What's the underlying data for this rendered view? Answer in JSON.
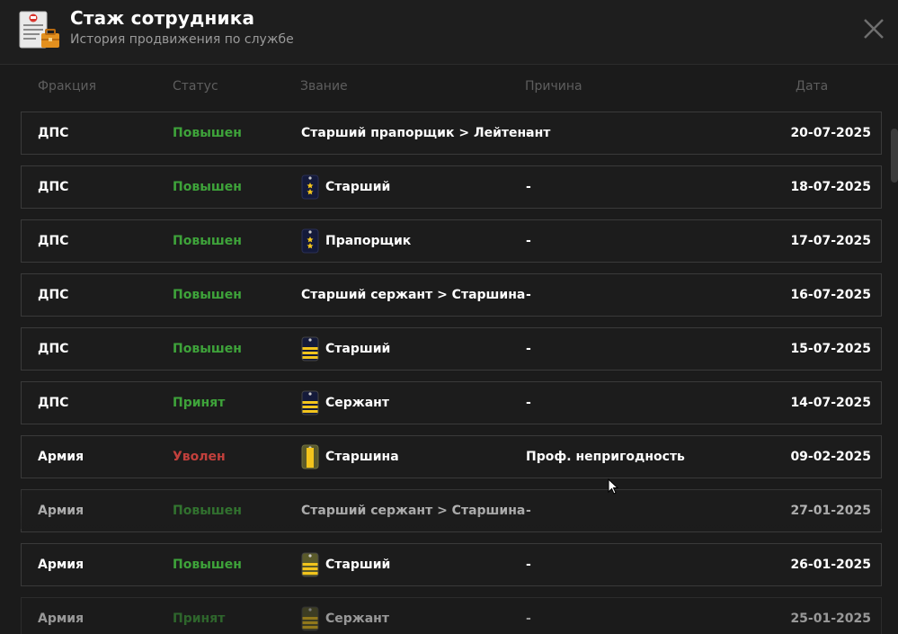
{
  "header": {
    "title": "Стаж сотрудника",
    "subtitle": "История продвижения по службе",
    "app_icon": "document-briefcase-icon",
    "close_icon": "close-icon"
  },
  "columns": {
    "faction": "Фракция",
    "status": "Статус",
    "rank": "Звание",
    "reason": "Причина",
    "date": "Дата"
  },
  "colors": {
    "promoted": "#3ea33a",
    "dismissed": "#c2403c",
    "rank_gold": "#f2c41c",
    "rank_navy": "#141a3a",
    "rank_olive": "#5a5a2a"
  },
  "rows": [
    {
      "faction": "ДПС",
      "status": "Повышен",
      "status_color": "green",
      "rank": "Старший прапорщик > Лейтенант",
      "rank_icon": "",
      "reason": "-",
      "date": "20-07-2025"
    },
    {
      "faction": "ДПС",
      "status": "Повышен",
      "status_color": "green",
      "rank": "Старший",
      "rank_icon": "navy-two-stars-shoulder-board-icon",
      "reason": "-",
      "date": "18-07-2025"
    },
    {
      "faction": "ДПС",
      "status": "Повышен",
      "status_color": "green",
      "rank": "Прапорщик",
      "rank_icon": "navy-two-stars-shoulder-board-icon",
      "reason": "-",
      "date": "17-07-2025"
    },
    {
      "faction": "ДПС",
      "status": "Повышен",
      "status_color": "green",
      "rank": "Старший сержант > Старшина",
      "rank_icon": "",
      "reason": "-",
      "date": "16-07-2025"
    },
    {
      "faction": "ДПС",
      "status": "Повышен",
      "status_color": "green",
      "rank": "Старший",
      "rank_icon": "navy-gold-stripes-shoulder-board-icon",
      "reason": "-",
      "date": "15-07-2025"
    },
    {
      "faction": "ДПС",
      "status": "Принят",
      "status_color": "green",
      "rank": "Сержант",
      "rank_icon": "navy-gold-stripes-shoulder-board-icon",
      "reason": "-",
      "date": "14-07-2025"
    },
    {
      "faction": "Армия",
      "status": "Уволен",
      "status_color": "red",
      "rank": "Старшина",
      "rank_icon": "olive-gold-wide-stripe-shoulder-board-icon",
      "reason": "Проф. непригодность",
      "date": "09-02-2025"
    },
    {
      "faction": "Армия",
      "status": "Повышен",
      "status_color": "green",
      "rank": "Старший сержант > Старшина",
      "rank_icon": "",
      "reason": "-",
      "date": "27-01-2025"
    },
    {
      "faction": "Армия",
      "status": "Повышен",
      "status_color": "green",
      "rank": "Старший",
      "rank_icon": "olive-gold-stripes-shoulder-board-icon",
      "reason": "-",
      "date": "26-01-2025"
    },
    {
      "faction": "Армия",
      "status": "Принят",
      "status_color": "green",
      "rank": "Сержант",
      "rank_icon": "olive-gold-stripes-shoulder-board-icon",
      "reason": "-",
      "date": "25-01-2025"
    }
  ]
}
